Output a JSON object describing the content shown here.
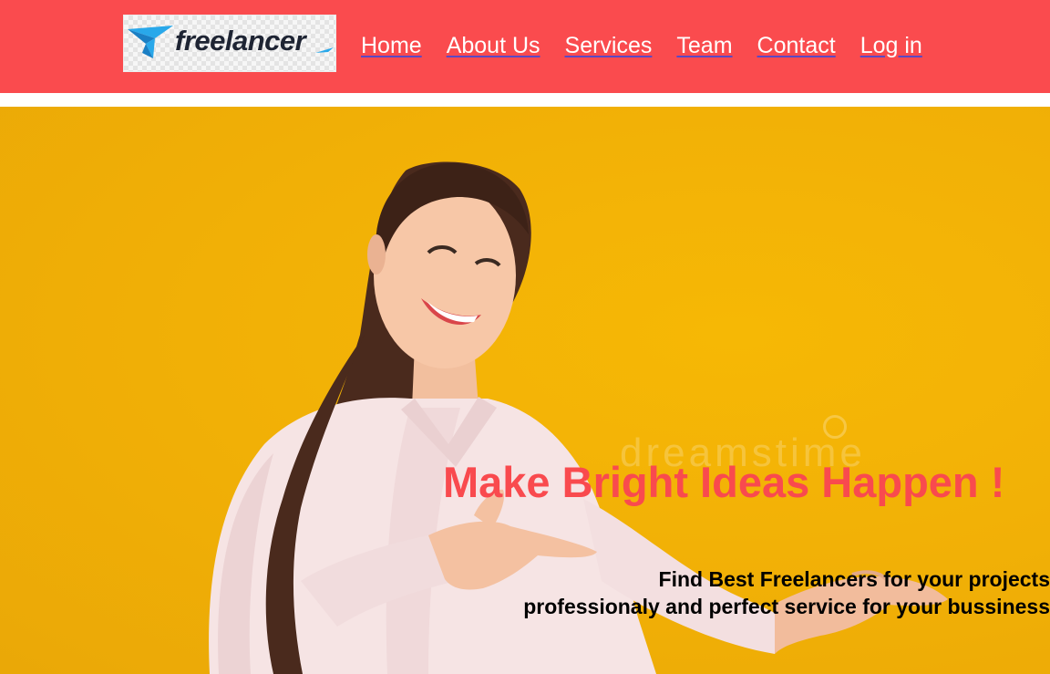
{
  "brand": {
    "name": "freelancer",
    "colors": {
      "header": "#fa4b4e",
      "accent": "#f94a4e",
      "logo_blue": "#29a8ea",
      "hero_background": "#f2b106"
    }
  },
  "nav": {
    "items": [
      {
        "label": "Home"
      },
      {
        "label": "About Us"
      },
      {
        "label": "Services"
      },
      {
        "label": "Team"
      },
      {
        "label": "Contact"
      },
      {
        "label": "Log in"
      }
    ]
  },
  "hero": {
    "headline": "Make Bright Ideas Happen !",
    "subtitle_line1": "Find Best Freelancers for your projects",
    "subtitle_line2": "professionaly and perfect service for your bussiness",
    "watermark": "dreamstime",
    "image": "woman-pointing-photo"
  }
}
